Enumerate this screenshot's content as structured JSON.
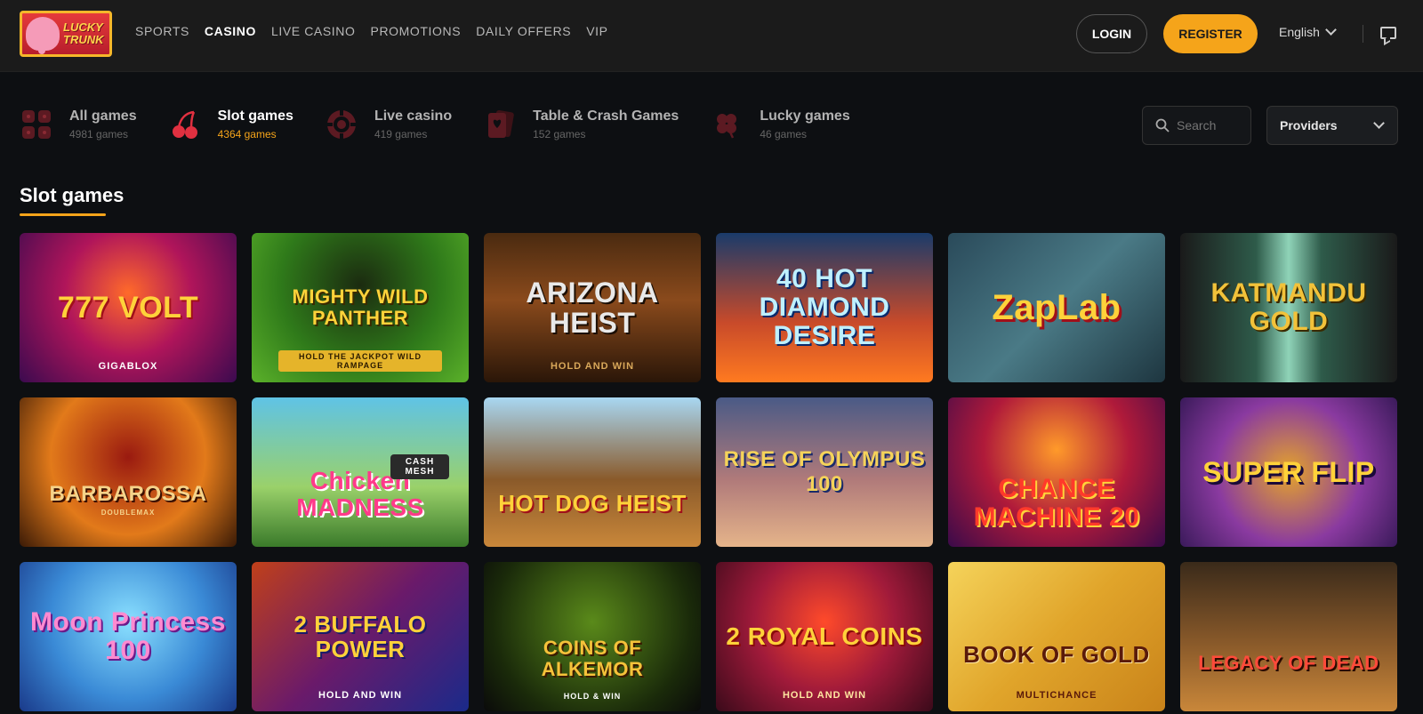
{
  "brand": {
    "logo_text_line1": "LUCKY",
    "logo_text_line2": "TRUNK"
  },
  "nav": {
    "items": [
      "SPORTS",
      "CASINO",
      "LIVE CASINO",
      "PROMOTIONS",
      "DAILY OFFERS",
      "VIP"
    ],
    "active": "CASINO"
  },
  "header": {
    "login_label": "LOGIN",
    "register_label": "REGISTER",
    "language": "English"
  },
  "categories": [
    {
      "title": "All games",
      "count": "4981 games",
      "icon": "grid-icon"
    },
    {
      "title": "Slot games",
      "count": "4364 games",
      "icon": "cherry-icon",
      "active": true
    },
    {
      "title": "Live casino",
      "count": "419 games",
      "icon": "roulette-chip-icon"
    },
    {
      "title": "Table & Crash Games",
      "count": "152 games",
      "icon": "cards-icon"
    },
    {
      "title": "Lucky games",
      "count": "46 games",
      "icon": "clover-icon"
    }
  ],
  "search": {
    "placeholder": "Search"
  },
  "providers": {
    "label": "Providers"
  },
  "section": {
    "title": "Slot games"
  },
  "games": [
    {
      "title": "777 VOLT",
      "sub": "GIGABLOX"
    },
    {
      "title": "MIGHTY WILD PANTHER",
      "sub": "HOLD THE JACKPOT WILD RAMPAGE"
    },
    {
      "title": "ARIZONA HEIST",
      "sub": "HOLD AND WIN"
    },
    {
      "title": "40 HOT DIAMOND DESIRE",
      "sub": ""
    },
    {
      "title": "ZapLab",
      "sub": ""
    },
    {
      "title": "KATMANDU GOLD",
      "sub": ""
    },
    {
      "title": "BARBAROSSA",
      "sub": "DOUBLEMAX"
    },
    {
      "title": "Chicken MADNESS",
      "sub": "CASH MESH"
    },
    {
      "title": "HOT DOG HEIST",
      "sub": ""
    },
    {
      "title": "RISE OF OLYMPUS 100",
      "sub": ""
    },
    {
      "title": "CHANCE machine 20",
      "sub": ""
    },
    {
      "title": "SUPER FLIP",
      "sub": ""
    },
    {
      "title": "Moon Princess 100",
      "sub": ""
    },
    {
      "title": "2 BUFFALO POWER",
      "sub": "HOLD AND WIN"
    },
    {
      "title": "COINS of ALKEMOR",
      "sub": "HOLD & WIN"
    },
    {
      "title": "2 ROYAL COINS",
      "sub": "HOLD AND WIN"
    },
    {
      "title": "BOOK of GOLD",
      "sub": "MULTICHANCE"
    },
    {
      "title": "LEGACY OF DEAD",
      "sub": ""
    }
  ]
}
